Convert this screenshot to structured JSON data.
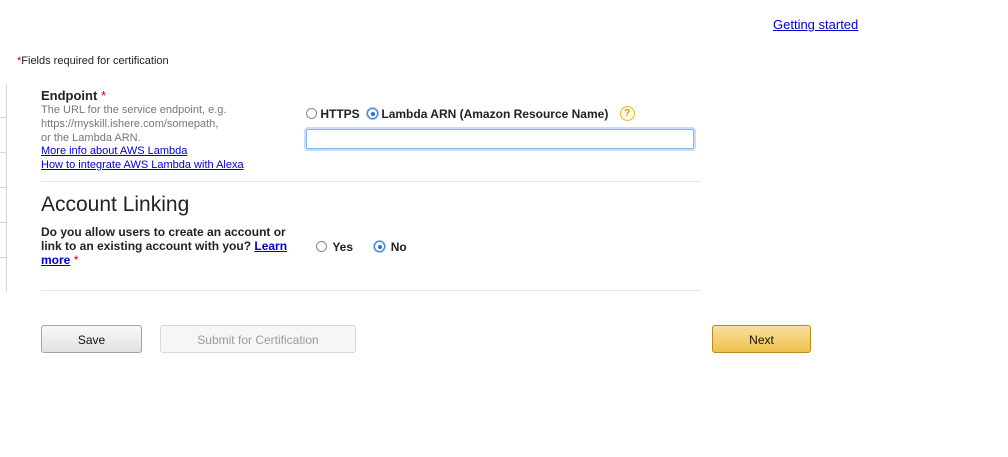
{
  "header": {
    "getting_started": "Getting started"
  },
  "required_note": {
    "star": "*",
    "text": "Fields required for certification"
  },
  "endpoint": {
    "label": "Endpoint",
    "star": "*",
    "description_lines": [
      "The URL for the service endpoint, e.g.",
      "https://myskill.ishere.com/somepath,",
      "or the Lambda ARN."
    ],
    "link_more_info": "More info about AWS Lambda",
    "link_integrate": "How to integrate AWS Lambda with Alexa",
    "options": [
      {
        "label": "HTTPS",
        "selected": false
      },
      {
        "label": "Lambda ARN (Amazon Resource Name)",
        "selected": true
      }
    ],
    "help_icon": "question-mark",
    "arn_value": ""
  },
  "account_linking": {
    "heading": "Account Linking",
    "question": "Do you allow users to create an account or link to an existing account with you?",
    "learn_more": "Learn more",
    "star": "*",
    "options": [
      {
        "label": "Yes",
        "selected": false
      },
      {
        "label": "No",
        "selected": true
      }
    ]
  },
  "buttons": {
    "save": "Save",
    "submit": "Submit for Certification",
    "next": "Next"
  },
  "colors": {
    "link": "#0000cc",
    "required_star": "#cc0000",
    "next_button": "#efc24c",
    "radio_selected": "#2a6fd1"
  }
}
